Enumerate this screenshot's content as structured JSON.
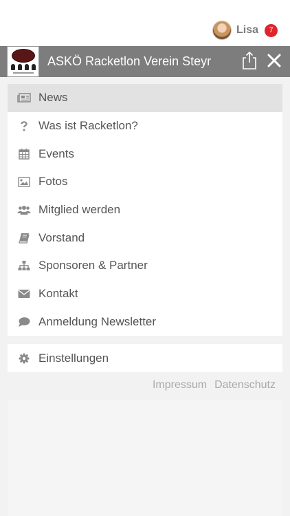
{
  "user": {
    "name": "Lisa",
    "notifications": "7"
  },
  "header": {
    "title": "ASKÖ Racketlon Verein Steyr",
    "logo_text": "RACKETLON"
  },
  "menu": {
    "items": [
      {
        "label": "News",
        "icon": "newspaper-icon"
      },
      {
        "label": "Was ist Racketlon?",
        "icon": "question-icon"
      },
      {
        "label": "Events",
        "icon": "calendar-icon"
      },
      {
        "label": "Fotos",
        "icon": "image-icon"
      },
      {
        "label": "Mitglied werden",
        "icon": "users-icon"
      },
      {
        "label": "Vorstand",
        "icon": "book-icon"
      },
      {
        "label": "Sponsoren & Partner",
        "icon": "sitemap-icon"
      },
      {
        "label": "Kontakt",
        "icon": "envelope-icon"
      },
      {
        "label": "Anmeldung Newsletter",
        "icon": "comment-icon"
      }
    ],
    "settings": {
      "label": "Einstellungen",
      "icon": "gear-icon"
    }
  },
  "footer": {
    "impressum": "Impressum",
    "datenschutz": "Datenschutz"
  },
  "colors": {
    "header_bg": "#7d7d7d",
    "badge": "#e0242b",
    "active_item_bg": "#e2e2e2",
    "icon": "#8a8a8a"
  }
}
